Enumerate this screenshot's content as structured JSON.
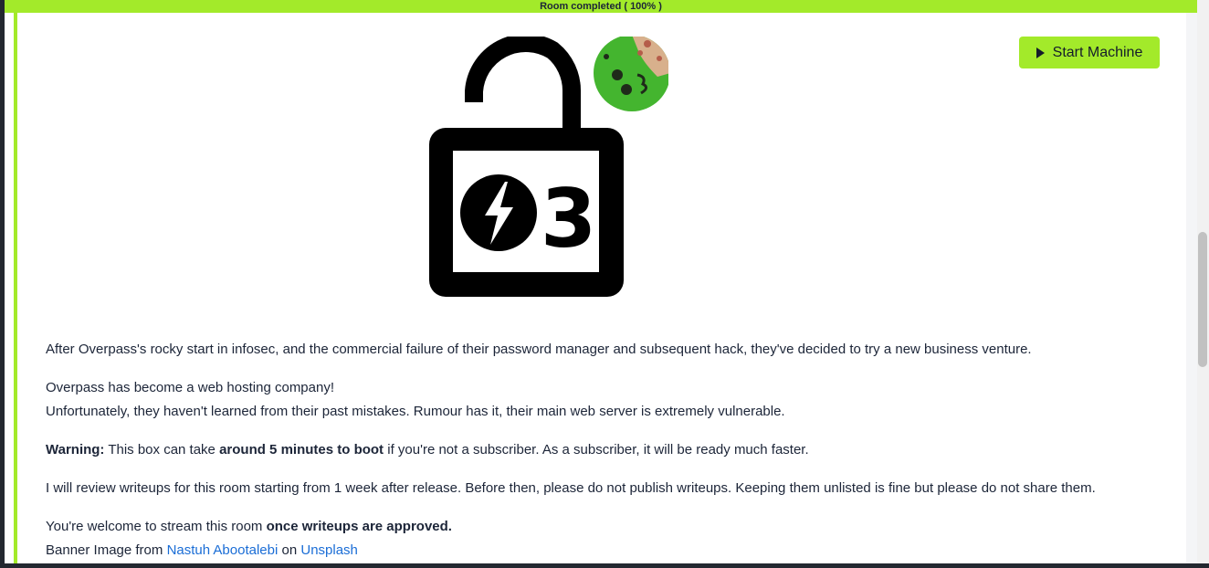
{
  "progress": {
    "label": "Room completed ( 100% )",
    "percent": 100,
    "color": "#a3ea2a"
  },
  "toolbar": {
    "start_machine_label": "Start Machine",
    "start_machine_icon": "play-icon"
  },
  "banner": {
    "icons": [
      "open-padlock-icon",
      "lightning-bolt-icon",
      "cookie-icon"
    ],
    "padlock_text": "3"
  },
  "content": {
    "p1": "After Overpass's rocky start in infosec, and the commercial failure of their password manager and subsequent hack, they've decided to try a new business venture.",
    "p2_line1": "Overpass has become a web hosting company!",
    "p2_line2": "Unfortunately, they haven't learned from their past mistakes. Rumour has it, their main web server is extremely vulnerable.",
    "warning_label": "Warning:",
    "warning_text_1": " This box can take ",
    "warning_bold": "around 5 minutes to boot",
    "warning_text_2": " if you're not a subscriber. As a subscriber, it will be ready much faster.",
    "p4": "I will review writeups for this room starting from 1 week after release. Before then, please do not publish writeups. Keeping them unlisted is fine but please do not share them.",
    "p5_text": "You're welcome to stream this room ",
    "p5_bold": "once writeups are approved.",
    "credit_prefix": "Banner Image from ",
    "credit_author": "Nastuh Abootalebi",
    "credit_mid": " on ",
    "credit_site": "Unsplash"
  },
  "colors": {
    "accent": "#a3ea2a",
    "text": "#1c2538",
    "link": "#1a6dd6"
  }
}
